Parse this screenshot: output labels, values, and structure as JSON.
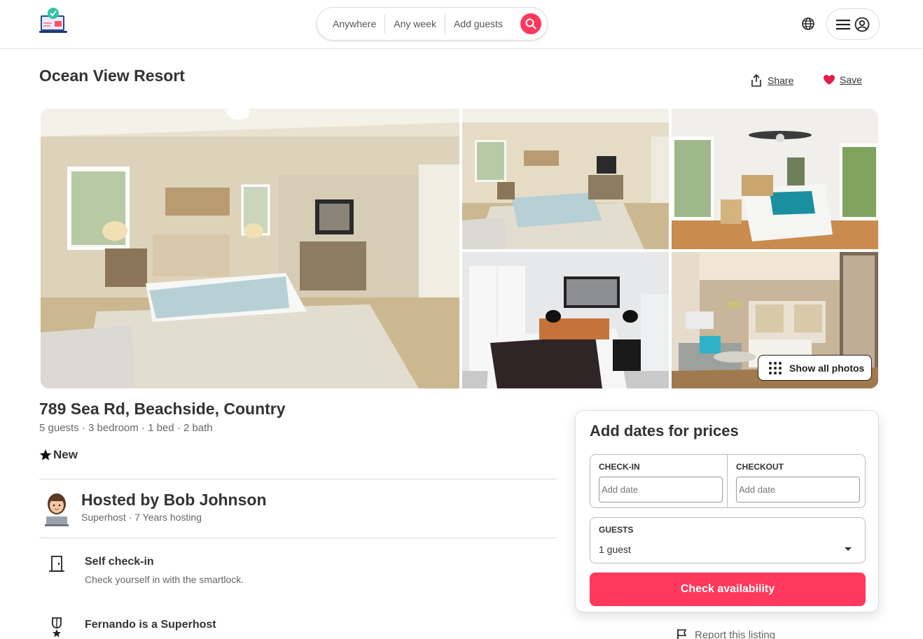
{
  "header": {
    "search": {
      "anywhere": "Anywhere",
      "any_week": "Any week",
      "add_guests": "Add guests"
    }
  },
  "listing": {
    "title": "Ocean View Resort",
    "share_label": "Share",
    "save_label": "Save",
    "show_all_photos": "Show all photos",
    "address": "789 Sea Rd, Beachside, Country",
    "facts": "5 guests · 3 bedroom · 1 bed · 2 bath",
    "rating_label": "New"
  },
  "host": {
    "name": "Hosted by Bob Johnson",
    "subtitle": "Superhost · 7 Years hosting"
  },
  "features": [
    {
      "title": "Self check-in",
      "description": "Check yourself in with the smartlock.",
      "icon": "door-icon"
    },
    {
      "title": "Fernando is a Superhost",
      "description": "",
      "icon": "medal-icon"
    }
  ],
  "booking": {
    "title": "Add dates for prices",
    "checkin_label": "CHECK-IN",
    "checkout_label": "CHECKOUT",
    "checkin_placeholder": "Add date",
    "checkout_placeholder": "Add date",
    "guests_label": "GUESTS",
    "guests_value": "1 guest",
    "button_label": "Check availability"
  },
  "report_label": "Report this listing",
  "colors": {
    "accent": "#ff385c",
    "heart": "#e11d48"
  }
}
